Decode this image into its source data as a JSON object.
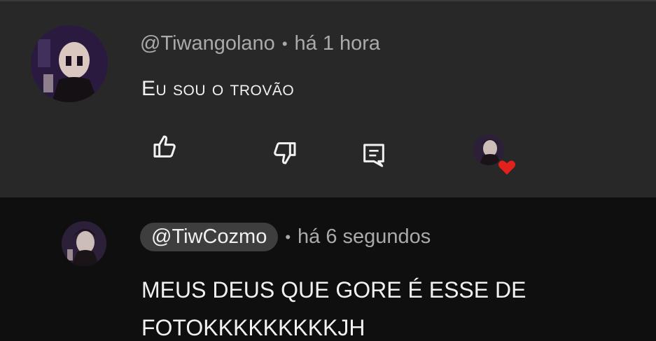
{
  "comment": {
    "author": "@Tiwangolano",
    "time": "há 1 hora",
    "text": "Eu sou o trovão",
    "actions": {
      "like_icon": "thumbs-up-icon",
      "dislike_icon": "thumbs-down-icon",
      "reply_icon": "reply-comment-icon",
      "creator_heart_icon": "creator-heart-icon"
    }
  },
  "reply": {
    "author": "@TiwCozmo",
    "time": "há 6 segundos",
    "text_line1": "MEUS DEUS QUE GORE É ESSE DE",
    "text_line2": "FOTOKKKKKKKKKJH"
  },
  "colors": {
    "top_bg": "#282828",
    "reply_bg": "#0f0f0f",
    "secondary_text": "#aaaaaa",
    "heart": "#e2211c"
  }
}
